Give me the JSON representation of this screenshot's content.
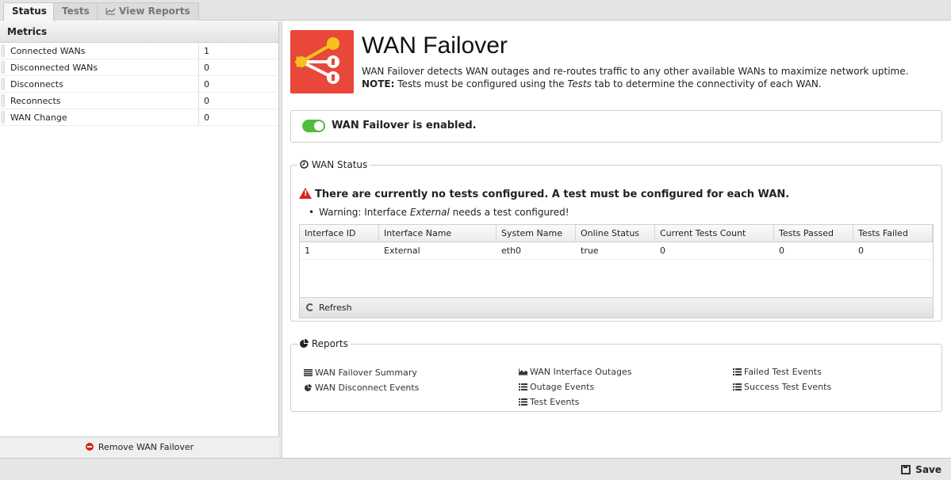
{
  "tabs": [
    {
      "label": "Status",
      "active": true
    },
    {
      "label": "Tests",
      "active": false
    },
    {
      "label": "View Reports",
      "active": false
    }
  ],
  "metrics": {
    "header": "Metrics",
    "rows": [
      {
        "key": "Connected WANs",
        "value": "1"
      },
      {
        "key": "Disconnected WANs",
        "value": "0"
      },
      {
        "key": "Disconnects",
        "value": "0"
      },
      {
        "key": "Reconnects",
        "value": "0"
      },
      {
        "key": "WAN Change",
        "value": "0"
      }
    ],
    "remove_label": "Remove WAN Failover"
  },
  "app": {
    "title": "WAN Failover",
    "description": "WAN Failover detects WAN outages and re-routes traffic to any other available WANs to maximize network uptime.",
    "note_label": "NOTE:",
    "note_pre": " Tests must be configured using the ",
    "note_em": "Tests",
    "note_post": " tab to determine the connectivity of each WAN.",
    "accent": "#e8473a"
  },
  "status": {
    "enabled_text": "WAN Failover is enabled.",
    "toggle_on": true,
    "toggle_color": "#4fbd3b"
  },
  "wan_status": {
    "legend": "WAN Status",
    "warning": "There are currently no tests configured. A test must be configured for each WAN.",
    "item_pre": "Warning: Interface ",
    "item_em": "External",
    "item_post": " needs a test configured!",
    "columns": [
      "Interface ID",
      "Interface Name",
      "System Name",
      "Online Status",
      "Current Tests Count",
      "Tests Passed",
      "Tests Failed"
    ],
    "rows": [
      [
        "1",
        "External",
        "eth0",
        "true",
        "0",
        "0",
        "0"
      ]
    ],
    "refresh_label": "Refresh"
  },
  "reports": {
    "legend": "Reports",
    "col1": [
      {
        "label": "WAN Failover Summary",
        "icon": "list-icon"
      },
      {
        "label": "WAN Disconnect Events",
        "icon": "pie-chart-icon"
      }
    ],
    "col2": [
      {
        "label": "WAN Interface Outages",
        "icon": "area-chart-icon"
      },
      {
        "label": "Outage Events",
        "icon": "list-ul-icon"
      },
      {
        "label": "Test Events",
        "icon": "list-ul-icon"
      }
    ],
    "col3": [
      {
        "label": "Failed Test Events",
        "icon": "list-ul-icon"
      },
      {
        "label": "Success Test Events",
        "icon": "list-ul-icon"
      }
    ]
  },
  "footer": {
    "save_label": "Save"
  }
}
